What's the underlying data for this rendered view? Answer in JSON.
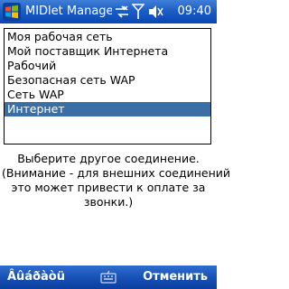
{
  "titlebar": {
    "title": "MIDlet Manage",
    "time": "09:40"
  },
  "list": {
    "items": [
      {
        "label": "Моя рабочая сеть",
        "selected": false
      },
      {
        "label": "Мой поставщик Интернета",
        "selected": false
      },
      {
        "label": "Рабочий",
        "selected": false
      },
      {
        "label": "Безопасная сеть WAP",
        "selected": false
      },
      {
        "label": "Сеть WAP",
        "selected": false
      },
      {
        "label": "Интернет",
        "selected": true
      }
    ]
  },
  "message": {
    "lines": [
      "Выберите другое соединение.",
      "(Внимание - для внешних соединений",
      "это может привести к оплате за",
      "звонки.)"
    ]
  },
  "menubar": {
    "left_label": "Âûáðàòü",
    "right_label": "Отменить"
  },
  "colors": {
    "titlebar": "#1c5ec7",
    "selection": "#3a6ea5",
    "menubar": "#164fb5"
  },
  "icons": [
    "windows-start-icon",
    "connectivity-icon",
    "signal-icon",
    "volume-icon",
    "keyboard-icon"
  ]
}
